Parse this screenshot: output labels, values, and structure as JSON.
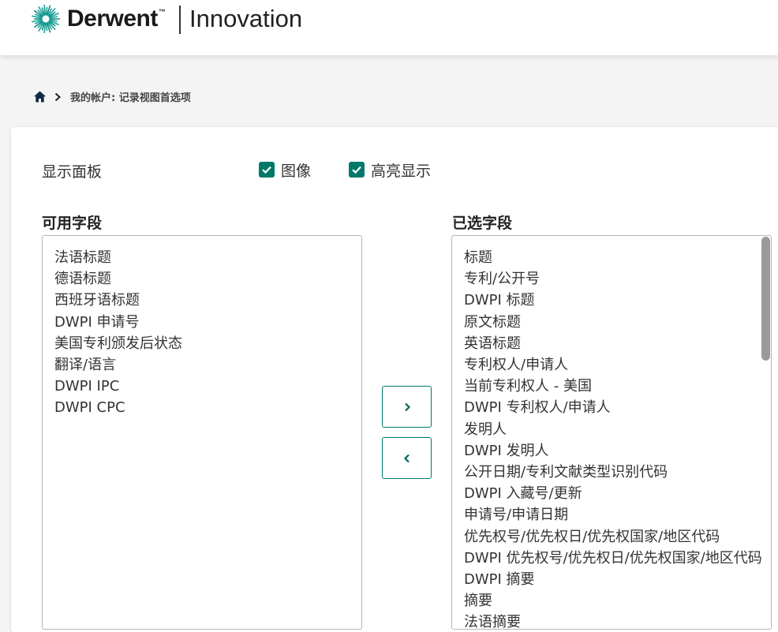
{
  "header": {
    "brand": "Derwent",
    "trademark": "™",
    "product": "Innovation"
  },
  "breadcrumb": {
    "text": "我的帐户: 记录视图首选项"
  },
  "display_panel": {
    "label": "显示面板",
    "options": [
      {
        "label": "图像",
        "checked": true
      },
      {
        "label": "高亮显示",
        "checked": true
      }
    ]
  },
  "available_fields": {
    "title": "可用字段",
    "items": [
      "法语标题",
      "德语标题",
      "西班牙语标题",
      "DWPI 申请号",
      "美国专利颁发后状态",
      "翻译/语言",
      "DWPI IPC",
      "DWPI CPC"
    ]
  },
  "selected_fields": {
    "title": "已选字段",
    "items": [
      "标题",
      "专利/公开号",
      "DWPI 标题",
      "原文标题",
      "英语标题",
      "专利权人/申请人",
      "当前专利权人 - 美国",
      "DWPI 专利权人/申请人",
      "发明人",
      "DWPI 发明人",
      "公开日期/专利文献类型识别代码",
      "DWPI 入藏号/更新",
      "申请号/申请日期",
      "优先权号/优先权日/优先权国家/地区代码",
      "DWPI 优先权号/优先权日/优先权国家/地区代码",
      "DWPI 摘要",
      "摘要",
      "法语摘要"
    ]
  },
  "colors": {
    "accent": "#00796b",
    "brand_teal": "#1aa39a"
  },
  "icons": {
    "logo": "derwent-sunburst-logo",
    "home": "home-icon",
    "separator": "chevron-right-icon",
    "move_right": "chevron-right-icon",
    "move_left": "chevron-left-icon",
    "checkbox": "checkmark-icon"
  }
}
